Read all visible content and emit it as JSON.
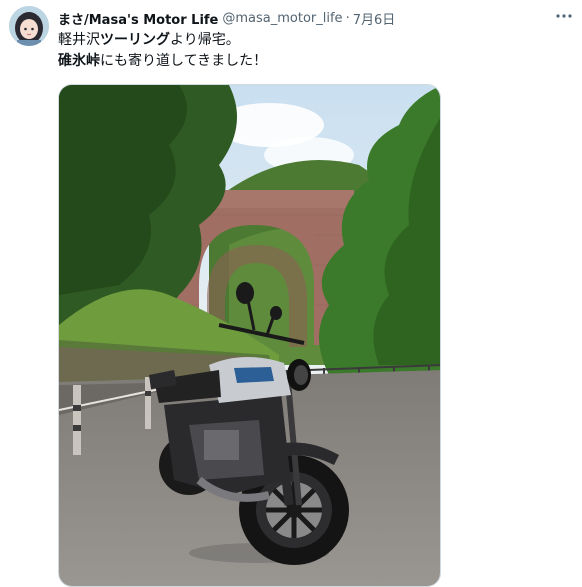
{
  "tweet": {
    "author_name": "まさ/Masa's Motor Life",
    "handle": "@masa_motor_life",
    "separator": "·",
    "date": "7月6日",
    "more_icon": "more-options-icon",
    "line1_pre": "軽井沢",
    "line1_bold": "ツーリング",
    "line1_post": "より帰宅。",
    "line2_bold": "碓氷峠",
    "line2_post": "にも寄り道してきました！"
  },
  "media": {
    "description_icon": "photo",
    "colors": {
      "sky": "#dce9f2",
      "foliage_dark": "#2f5a23",
      "foliage_light": "#6f9d3e",
      "brick": "#a8776c",
      "asphalt": "#8e8a86",
      "bike_body": "#2a2a2c"
    }
  }
}
